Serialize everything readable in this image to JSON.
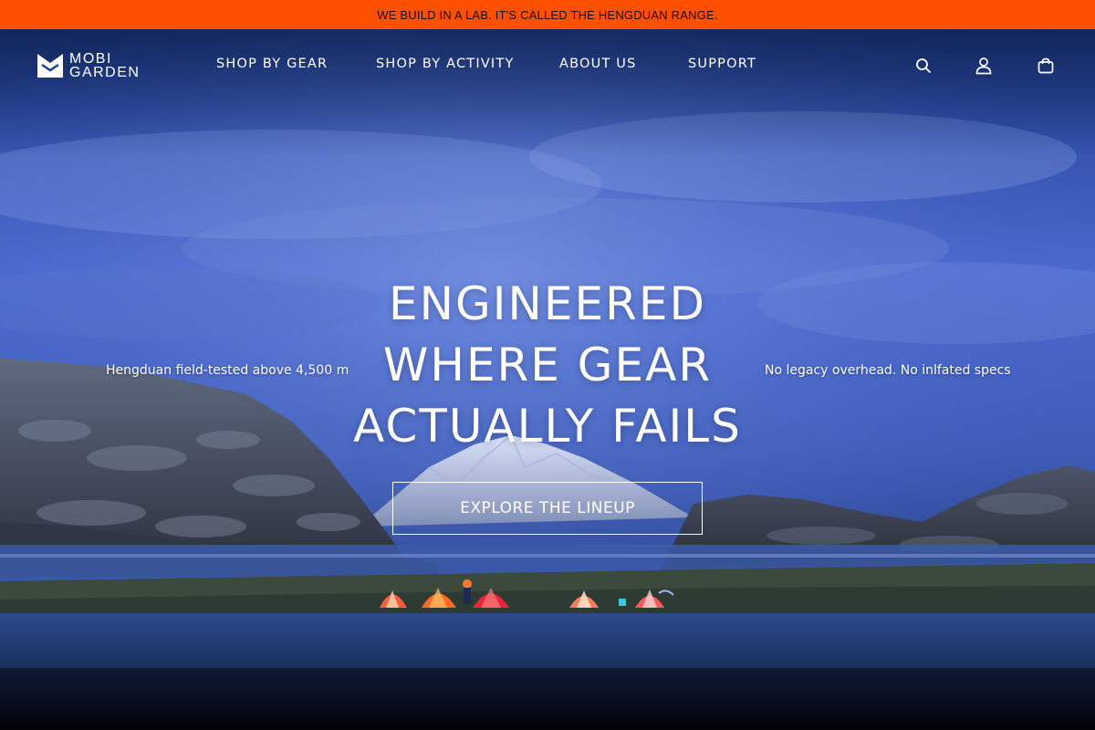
{
  "announcement": {
    "text": "WE BUILD IN A LAB. IT'S CALLED THE HENGDUAN RANGE.",
    "background": "#ff5000"
  },
  "header": {
    "logo": {
      "line1": "MOBI",
      "line2": "GARDEN"
    },
    "nav": [
      {
        "label": "SHOP BY GEAR"
      },
      {
        "label": "SHOP BY ACTIVITY"
      },
      {
        "label": "ABOUT US"
      },
      {
        "label": "SUPPORT"
      }
    ],
    "icons": [
      "search-icon",
      "account-icon",
      "shopping-bag-icon"
    ]
  },
  "hero": {
    "headline": [
      "ENGINEERED",
      "WHERE GEAR",
      "ACTUALLY FAILS"
    ],
    "left_note": "Hengduan field-tested above 4,500 m",
    "right_note": "No legacy overhead. No inlfated specs",
    "cta_label": "EXPLORE THE LINEUP"
  }
}
